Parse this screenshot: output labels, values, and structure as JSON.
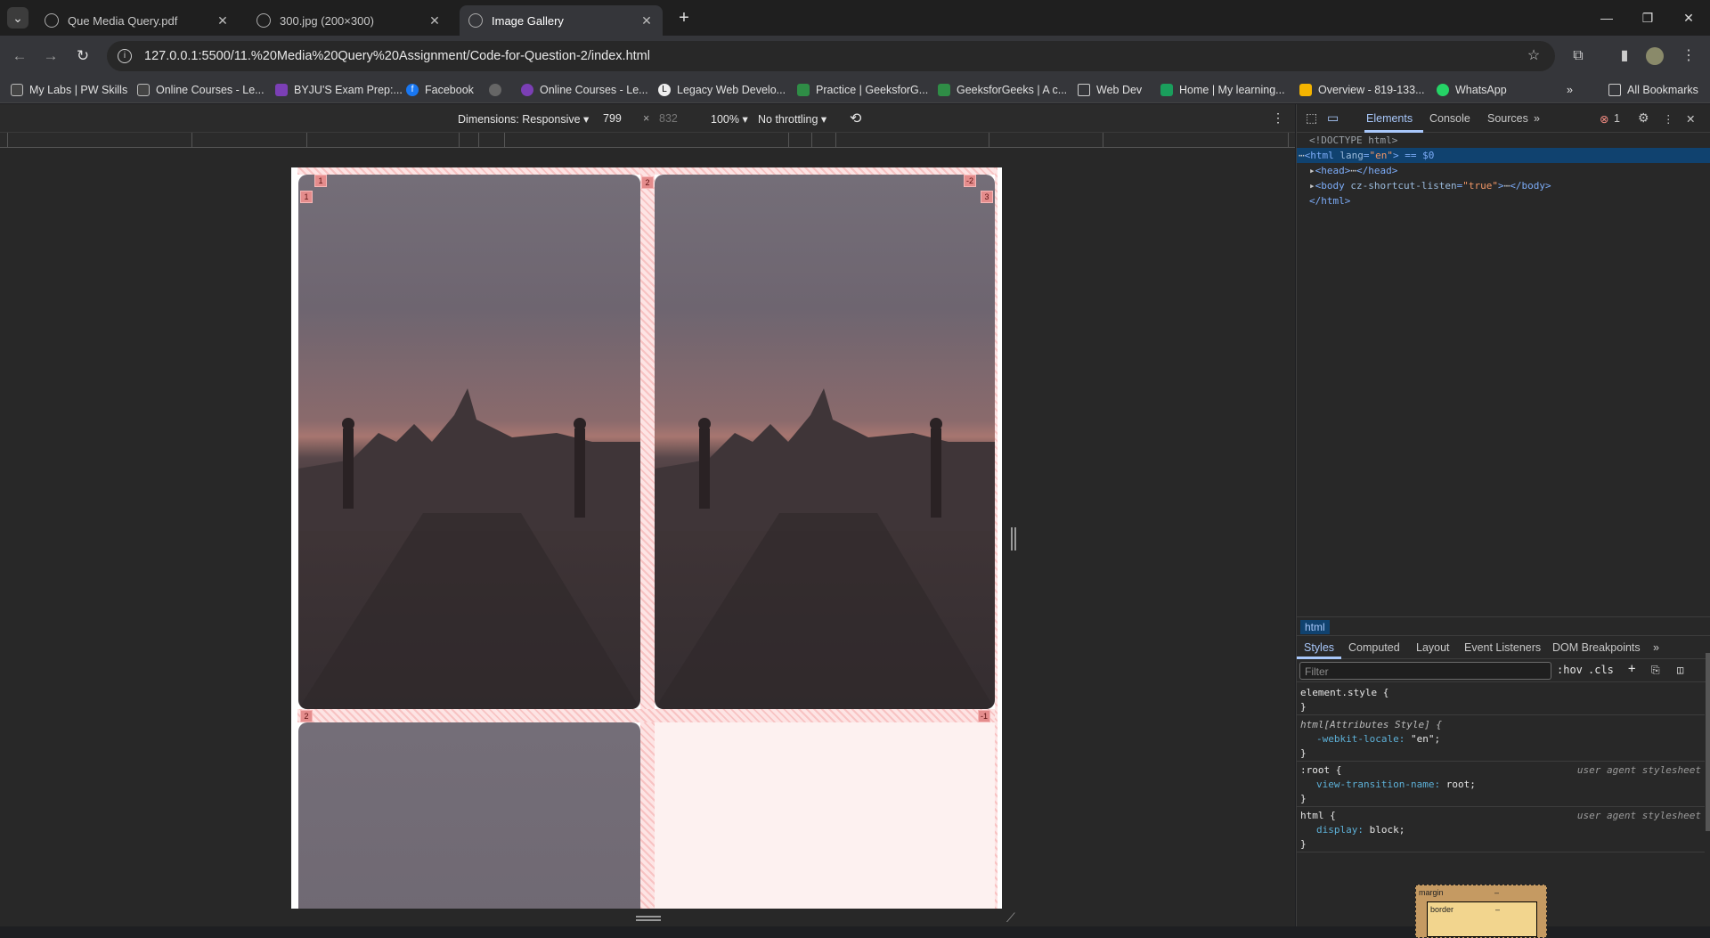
{
  "browser": {
    "tabs": [
      {
        "title": "Que Media Query.pdf",
        "active": false
      },
      {
        "title": "300.jpg (200×300)",
        "active": false
      },
      {
        "title": "Image Gallery",
        "active": true
      }
    ],
    "new_tab_label": "+",
    "address": "127.0.0.1:5500/11.%20Media%20Query%20Assignment/Code-for-Question-2/index.html",
    "bookmarks": [
      {
        "label": "My Labs | PW Skills",
        "color": "#444"
      },
      {
        "label": "Online Courses - Le...",
        "color": "#444"
      },
      {
        "label": "BYJU'S Exam Prep:...",
        "color": "#7b3fb5"
      },
      {
        "label": "Facebook",
        "color": "#1877f2"
      },
      {
        "label": "",
        "color": "#666"
      },
      {
        "label": "Online Courses - Le...",
        "color": "#7b3fb5"
      },
      {
        "label": "Legacy Web Develo...",
        "color": "#eee"
      },
      {
        "label": "Practice | GeeksforG...",
        "color": "#2f8d46"
      },
      {
        "label": "GeeksforGeeks | A c...",
        "color": "#2f8d46"
      },
      {
        "label": "Web Dev",
        "color": "folder"
      },
      {
        "label": "Home | My learning...",
        "color": "#1a9e5c"
      },
      {
        "label": "Overview - 819-133...",
        "color": "#f4b400"
      },
      {
        "label": "WhatsApp",
        "color": "#25d366"
      }
    ],
    "all_bookmarks": "All Bookmarks"
  },
  "device_toolbar": {
    "dimensions": "Dimensions: Responsive",
    "width": "799",
    "times": "×",
    "height": "832",
    "zoom": "100%",
    "throttling": "No throttling"
  },
  "gallery": {
    "grid_labels": {
      "col_top_left": "1",
      "row_top_left": "1",
      "col_mid": "2",
      "col_top_right": "-2",
      "row_top_right": "3",
      "row_mid_left": "2",
      "row_mid_right": "-1"
    }
  },
  "devtools": {
    "tabs": [
      "Elements",
      "Console",
      "Sources"
    ],
    "error_count": "1",
    "dom": [
      "<!DOCTYPE html>",
      "html",
      "head",
      "body"
    ],
    "dom_lines": {
      "doctype": "<!DOCTYPE html>",
      "html_open": "<html",
      "html_attr": "lang",
      "html_val": "\"en\"",
      "html_suffix": "> == $0",
      "head": "<head>",
      "head_close": "</head>",
      "body_open": "<body",
      "body_attr": "cz-shortcut-listen",
      "body_val": "\"true\"",
      "body_close": "</body>",
      "html_close": "</html>"
    },
    "breadcrumb": "html",
    "styles_tabs": [
      "Styles",
      "Computed",
      "Layout",
      "Event Listeners",
      "DOM Breakpoints"
    ],
    "filter_placeholder": "Filter",
    "filter_buttons": [
      ":hov",
      ".cls",
      "+"
    ],
    "rules": [
      {
        "selector": "element.style {",
        "source": "",
        "props": [],
        "close": "}"
      },
      {
        "selector": "html[Attributes Style] {",
        "source": "",
        "props": [
          {
            "name": "-webkit-locale",
            "value": "\"en\";"
          }
        ],
        "close": "}"
      },
      {
        "selector": ":root {",
        "source": "user agent stylesheet",
        "props": [
          {
            "name": "view-transition-name",
            "value": "root;"
          }
        ],
        "close": "}"
      },
      {
        "selector": "html {",
        "source": "user agent stylesheet",
        "props": [
          {
            "name": "display",
            "value": "block;"
          }
        ],
        "close": "}"
      }
    ],
    "box_model": {
      "margin": "margin",
      "margin_val": "–",
      "border": "border",
      "border_val": "–"
    }
  }
}
